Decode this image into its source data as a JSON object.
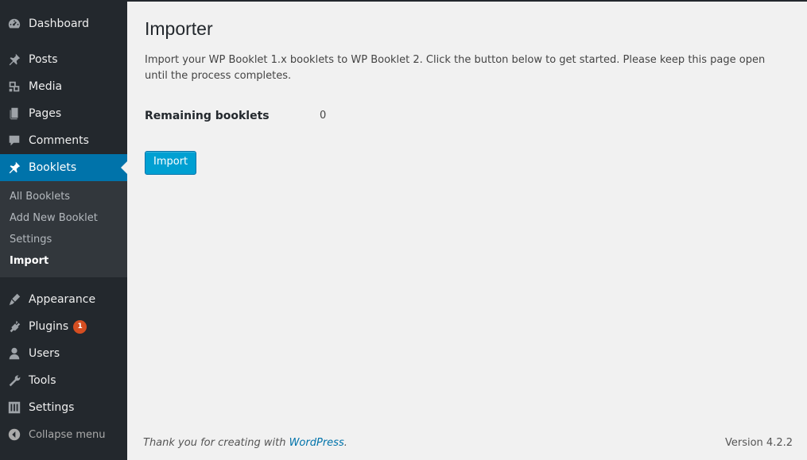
{
  "sidebar": {
    "items": [
      {
        "label": "Dashboard",
        "icon": "dashboard-icon"
      },
      {
        "label": "Posts",
        "icon": "pin-icon"
      },
      {
        "label": "Media",
        "icon": "media-icon"
      },
      {
        "label": "Pages",
        "icon": "pages-icon"
      },
      {
        "label": "Comments",
        "icon": "comment-icon"
      },
      {
        "label": "Booklets",
        "icon": "pin-icon",
        "active": true
      }
    ],
    "submenu": [
      "All Booklets",
      "Add New Booklet",
      "Settings",
      "Import"
    ],
    "items2": [
      {
        "label": "Appearance",
        "icon": "brush-icon"
      },
      {
        "label": "Plugins",
        "icon": "plugin-icon",
        "badge": "1"
      },
      {
        "label": "Users",
        "icon": "user-icon"
      },
      {
        "label": "Tools",
        "icon": "wrench-icon"
      },
      {
        "label": "Settings",
        "icon": "settings-icon"
      }
    ],
    "collapse_label": "Collapse menu"
  },
  "main": {
    "title": "Importer",
    "intro": "Import your WP Booklet 1.x booklets to WP Booklet 2. Click the button below to get started. Please keep this page open until the process completes.",
    "remaining_label": "Remaining booklets",
    "remaining_value": "0",
    "import_button": "Import"
  },
  "footer": {
    "thanks_prefix": "Thank you for creating with ",
    "thanks_link": "WordPress",
    "thanks_suffix": ".",
    "version": "Version 4.2.2"
  },
  "colors": {
    "sidebar_bg": "#23282d",
    "active": "#0073aa",
    "button": "#00a0d2",
    "badge": "#d54e21"
  }
}
